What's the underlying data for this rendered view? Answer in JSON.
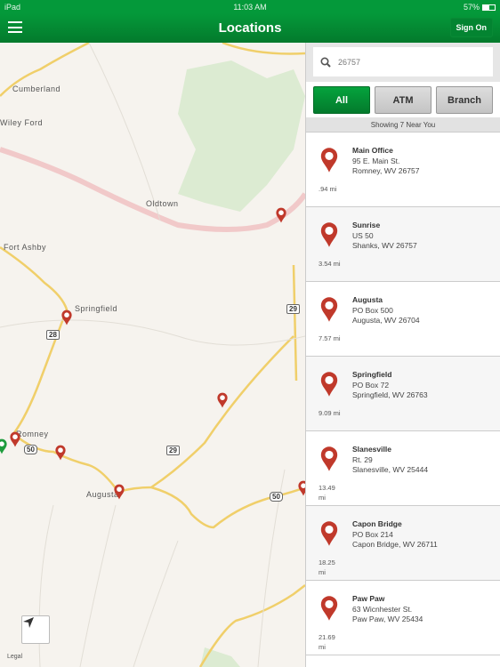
{
  "status": {
    "device": "iPad",
    "time": "11:03 AM",
    "battery": "57%",
    "battery_level": 0.57
  },
  "nav": {
    "title": "Locations",
    "sign_on": "Sign On"
  },
  "map": {
    "labels": [
      "Cumberland",
      "Wiley Ford",
      "Oldtown",
      "Fort Ashby",
      "Springfield",
      "Romney",
      "Augusta"
    ],
    "shields": [
      "28",
      "29",
      "29",
      "50",
      "50"
    ],
    "legal": "Legal",
    "pin_color": "#c0392b",
    "user_pin_color": "#1e9c3c"
  },
  "search": {
    "value": "26757"
  },
  "filters": [
    "All",
    "ATM",
    "Branch"
  ],
  "showing": "Showing 7 Near You",
  "locations": [
    {
      "name": "Main Office",
      "line1": "95 E. Main St.",
      "line2": "Romney, WV 26757",
      "distance": ".94 mi"
    },
    {
      "name": "Sunrise",
      "line1": "US 50",
      "line2": "Shanks, WV 26757",
      "distance": "3.54 mi"
    },
    {
      "name": "Augusta",
      "line1": "PO Box 500",
      "line2": "Augusta, WV 26704",
      "distance": "7.57 mi"
    },
    {
      "name": "Springfield",
      "line1": "PO Box 72",
      "line2": "Springfield, WV 26763",
      "distance": "9.09 mi"
    },
    {
      "name": "Slanesville",
      "line1": "Rt. 29",
      "line2": "Slanesville, WV 25444",
      "distance": "13.49 mi"
    },
    {
      "name": "Capon Bridge",
      "line1": "PO Box 214",
      "line2": "Capon Bridge, WV 26711",
      "distance": "18.25 mi"
    },
    {
      "name": "Paw Paw",
      "line1": "63 Wicnhester St.",
      "line2": "Paw Paw, WV 25434",
      "distance": "21.69 mi"
    }
  ]
}
